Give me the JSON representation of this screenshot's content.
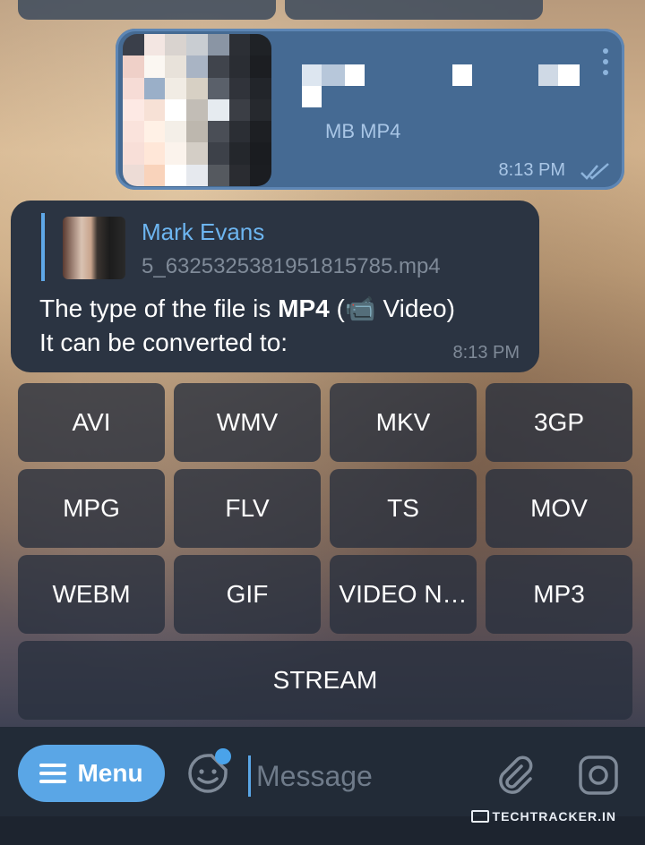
{
  "outgoing": {
    "file_size": "MB MP4",
    "time": "8:13 PM"
  },
  "incoming": {
    "reply_name": "Mark Evans",
    "reply_file": "5_6325325381951815785.mp4",
    "line1_pre": "The type of the file is ",
    "line1_bold": "MP4",
    "line1_post": " (📹 Video)",
    "line2": "It can be converted to:",
    "time": "8:13 PM"
  },
  "keyboard": {
    "rows": [
      [
        "AVI",
        "WMV",
        "MKV",
        "3GP"
      ],
      [
        "MPG",
        "FLV",
        "TS",
        "MOV"
      ],
      [
        "WEBM",
        "GIF",
        "VIDEO N…",
        "MP3"
      ],
      [
        "STREAM"
      ]
    ]
  },
  "input_bar": {
    "menu_label": "Menu",
    "placeholder": "Message"
  },
  "watermark": "TECHTRACKER.IN",
  "colors": {
    "accent": "#5aa6e6",
    "outgoing_bubble": "#456a93",
    "incoming_bubble": "#2b3442",
    "reply_name": "#6db5f0"
  },
  "icons": [
    "more-vertical-icon",
    "double-check-icon",
    "hamburger-icon",
    "sticker-icon",
    "attachment-icon",
    "camera-icon"
  ]
}
